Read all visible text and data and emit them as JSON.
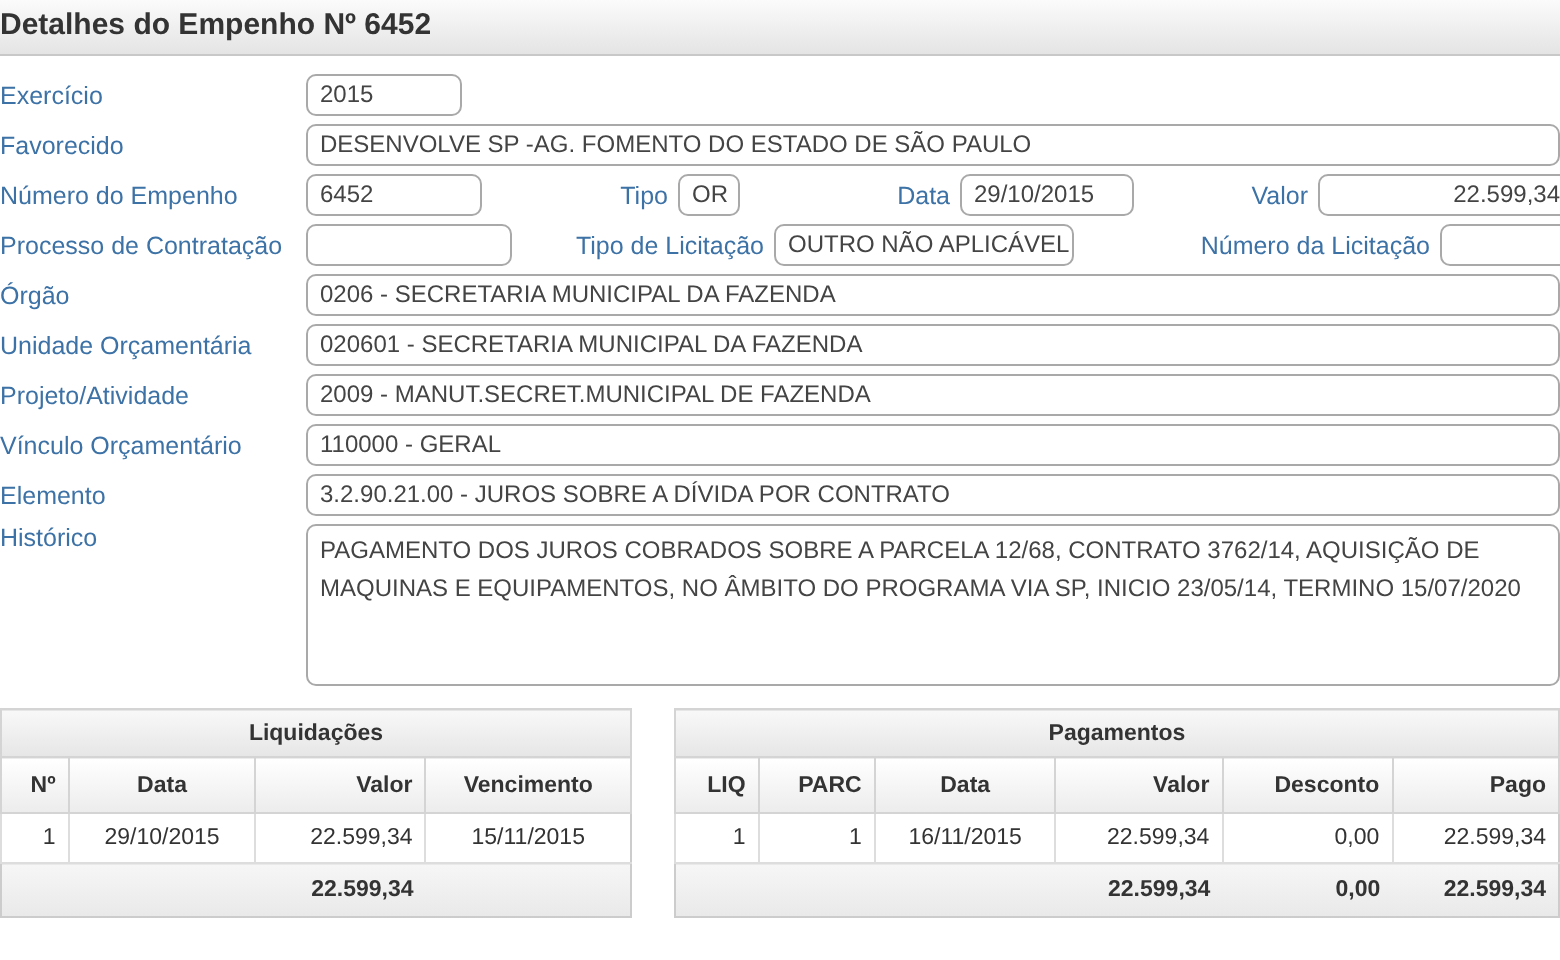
{
  "title": "Detalhes do Empenho Nº 6452",
  "form": [
    {
      "kind": "short",
      "fields": [
        {
          "label": "Exercício",
          "value": "2015"
        }
      ]
    },
    {
      "kind": "full",
      "fields": [
        {
          "label": "Favorecido",
          "value": "DESENVOLVE SP -AG. FOMENTO DO ESTADO DE SÃO PAULO"
        }
      ]
    },
    {
      "kind": "split4",
      "fields": [
        {
          "label": "Número do Empenho",
          "value": "6452"
        },
        {
          "label": "Tipo",
          "value": "OR"
        },
        {
          "label": "Data",
          "value": "29/10/2015"
        },
        {
          "label": "Valor",
          "value": "22.599,34"
        }
      ]
    },
    {
      "kind": "split3",
      "fields": [
        {
          "label": "Processo de Contratação"
        },
        {
          "label": "Tipo de Licitação",
          "value": "OUTRO NÃO APLICÁVEL"
        },
        {
          "label": "Número da Licitação"
        }
      ]
    },
    {
      "kind": "full",
      "fields": [
        {
          "label": "Órgão",
          "value": "0206 - SECRETARIA MUNICIPAL DA FAZENDA"
        }
      ]
    },
    {
      "kind": "full",
      "fields": [
        {
          "label": "Unidade Orçamentária",
          "value": "020601 - SECRETARIA MUNICIPAL DA FAZENDA"
        }
      ]
    },
    {
      "kind": "full",
      "fields": [
        {
          "label": "Projeto/Atividade",
          "value": "2009 - MANUT.SECRET.MUNICIPAL DE FAZENDA"
        }
      ]
    },
    {
      "kind": "full",
      "fields": [
        {
          "label": "Vínculo Orçamentário",
          "value": "110000 - GERAL"
        }
      ]
    },
    {
      "kind": "full",
      "fields": [
        {
          "label": "Elemento",
          "value": "3.2.90.21.00 - JUROS SOBRE A DÍVIDA POR CONTRATO"
        }
      ]
    },
    {
      "kind": "area",
      "fields": [
        {
          "label": "Histórico",
          "value": "PAGAMENTO DOS JUROS COBRADOS SOBRE A PARCELA 12/68, CONTRATO 3762/14, AQUISIÇÃO DE MAQUINAS E EQUIPAMENTOS, NO ÂMBITO DO PROGRAMA VIA SP, INICIO 23/05/14, TERMINO 15/07/2020"
        }
      ]
    }
  ],
  "tables": [
    {
      "title": "Liquidações",
      "columns": [
        "Nº",
        "Data",
        "Valor",
        "Vencimento"
      ],
      "rows": [
        [
          "1",
          "29/10/2015",
          "22.599,34",
          "15/11/2015"
        ]
      ],
      "totals": [
        "22.599,34"
      ]
    },
    {
      "title": "Pagamentos",
      "columns": [
        "LIQ",
        "PARC",
        "Data",
        "Valor",
        "Desconto",
        "Pago"
      ],
      "rows": [
        [
          "1",
          "1",
          "16/11/2015",
          "22.599,34",
          "0,00",
          "22.599,34"
        ]
      ],
      "totals": [
        "22.599,34",
        "0,00",
        "22.599,34"
      ]
    }
  ]
}
